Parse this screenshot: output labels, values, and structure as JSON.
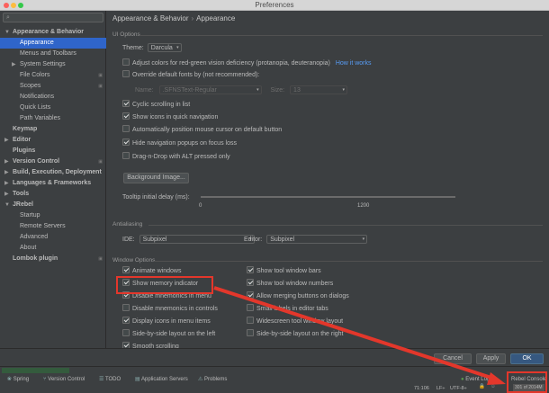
{
  "window": {
    "title": "Preferences"
  },
  "sidebar": {
    "items": [
      {
        "label": "Appearance & Behavior",
        "level": 0,
        "bold": true,
        "expanded": true
      },
      {
        "label": "Appearance",
        "level": 1,
        "selected": true
      },
      {
        "label": "Menus and Toolbars",
        "level": 1
      },
      {
        "label": "System Settings",
        "level": 1,
        "collapsed": true
      },
      {
        "label": "File Colors",
        "level": 1,
        "icon": true
      },
      {
        "label": "Scopes",
        "level": 1,
        "icon": true
      },
      {
        "label": "Notifications",
        "level": 1
      },
      {
        "label": "Quick Lists",
        "level": 1
      },
      {
        "label": "Path Variables",
        "level": 1
      },
      {
        "label": "Keymap",
        "level": 0,
        "bold": true
      },
      {
        "label": "Editor",
        "level": 0,
        "bold": true,
        "collapsed": true
      },
      {
        "label": "Plugins",
        "level": 0,
        "bold": true
      },
      {
        "label": "Version Control",
        "level": 0,
        "bold": true,
        "collapsed": true,
        "icon": true
      },
      {
        "label": "Build, Execution, Deployment",
        "level": 0,
        "bold": true,
        "collapsed": true
      },
      {
        "label": "Languages & Frameworks",
        "level": 0,
        "bold": true,
        "collapsed": true
      },
      {
        "label": "Tools",
        "level": 0,
        "bold": true,
        "collapsed": true
      },
      {
        "label": "JRebel",
        "level": 0,
        "bold": true,
        "expanded": true
      },
      {
        "label": "Startup",
        "level": 1
      },
      {
        "label": "Remote Servers",
        "level": 1
      },
      {
        "label": "Advanced",
        "level": 1
      },
      {
        "label": "About",
        "level": 1
      },
      {
        "label": "Lombok plugin",
        "level": 0,
        "bold": true,
        "icon": true
      }
    ]
  },
  "breadcrumb": {
    "part1": "Appearance & Behavior",
    "separator": "›",
    "part2": "Appearance"
  },
  "ui_options": {
    "section_label": "UI Options",
    "theme_label": "Theme:",
    "theme_value": "Darcula",
    "adjust_colors": "Adjust colors for red-green vision deficiency (protanopia, deuteranopia)",
    "how_it_works": "How it works",
    "override_fonts": "Override default fonts by (not recommended):",
    "name_label": "Name:",
    "name_value": ".SFNSText-Regular",
    "size_label": "Size:",
    "size_value": "13",
    "cyclic_scrolling": "Cyclic scrolling in list",
    "show_icons_quick_nav": "Show icons in quick navigation",
    "auto_position_mouse": "Automatically position mouse cursor on default button",
    "hide_nav_popups": "Hide navigation popups on focus loss",
    "drag_n_drop": "Drag-n-Drop with ALT pressed only",
    "background_image": "Background Image...",
    "tooltip_delay": "Tooltip initial delay (ms):",
    "slider_min": "0",
    "slider_max": "1200",
    "slider_value_fraction": 1.0
  },
  "antialiasing": {
    "section_label": "Antialiasing",
    "ide_label": "IDE:",
    "ide_value": "Subpixel",
    "editor_label": "Editor:",
    "editor_value": "Subpixel"
  },
  "window_options": {
    "section_label": "Window Options",
    "left": [
      {
        "label": "Animate windows",
        "checked": true
      },
      {
        "label": "Show memory indicator",
        "checked": true
      },
      {
        "label": "Disable mnemonics in menu",
        "checked": true
      },
      {
        "label": "Disable mnemonics in controls",
        "checked": false
      },
      {
        "label": "Display icons in menu items",
        "checked": true
      },
      {
        "label": "Side-by-side layout on the left",
        "checked": false
      },
      {
        "label": "Smooth scrolling",
        "checked": true
      }
    ],
    "right": [
      {
        "label": "Show tool window bars",
        "checked": true
      },
      {
        "label": "Show tool window numbers",
        "checked": true
      },
      {
        "label": "Allow merging buttons on dialogs",
        "checked": true
      },
      {
        "label": "Small labels in editor tabs",
        "checked": false
      },
      {
        "label": "Widescreen tool window layout",
        "checked": false
      },
      {
        "label": "Side-by-side layout on the right",
        "checked": false
      }
    ]
  },
  "buttons": {
    "help": "?",
    "cancel": "Cancel",
    "apply": "Apply",
    "ok": "OK"
  },
  "statusbar": {
    "tools": [
      "Spring",
      "Version Control",
      "TODO",
      "Application Servers",
      "Problems"
    ],
    "event_log": "Event Log",
    "rebel_console": "Rebel Console",
    "position": "71:106",
    "line_sep": "LF÷",
    "encoding": "UTF-8÷",
    "memory": "301 of 2014M"
  },
  "colors": {
    "accent": "#2f65ca",
    "annotation": "#e3372b",
    "primary_button": "#365880"
  }
}
